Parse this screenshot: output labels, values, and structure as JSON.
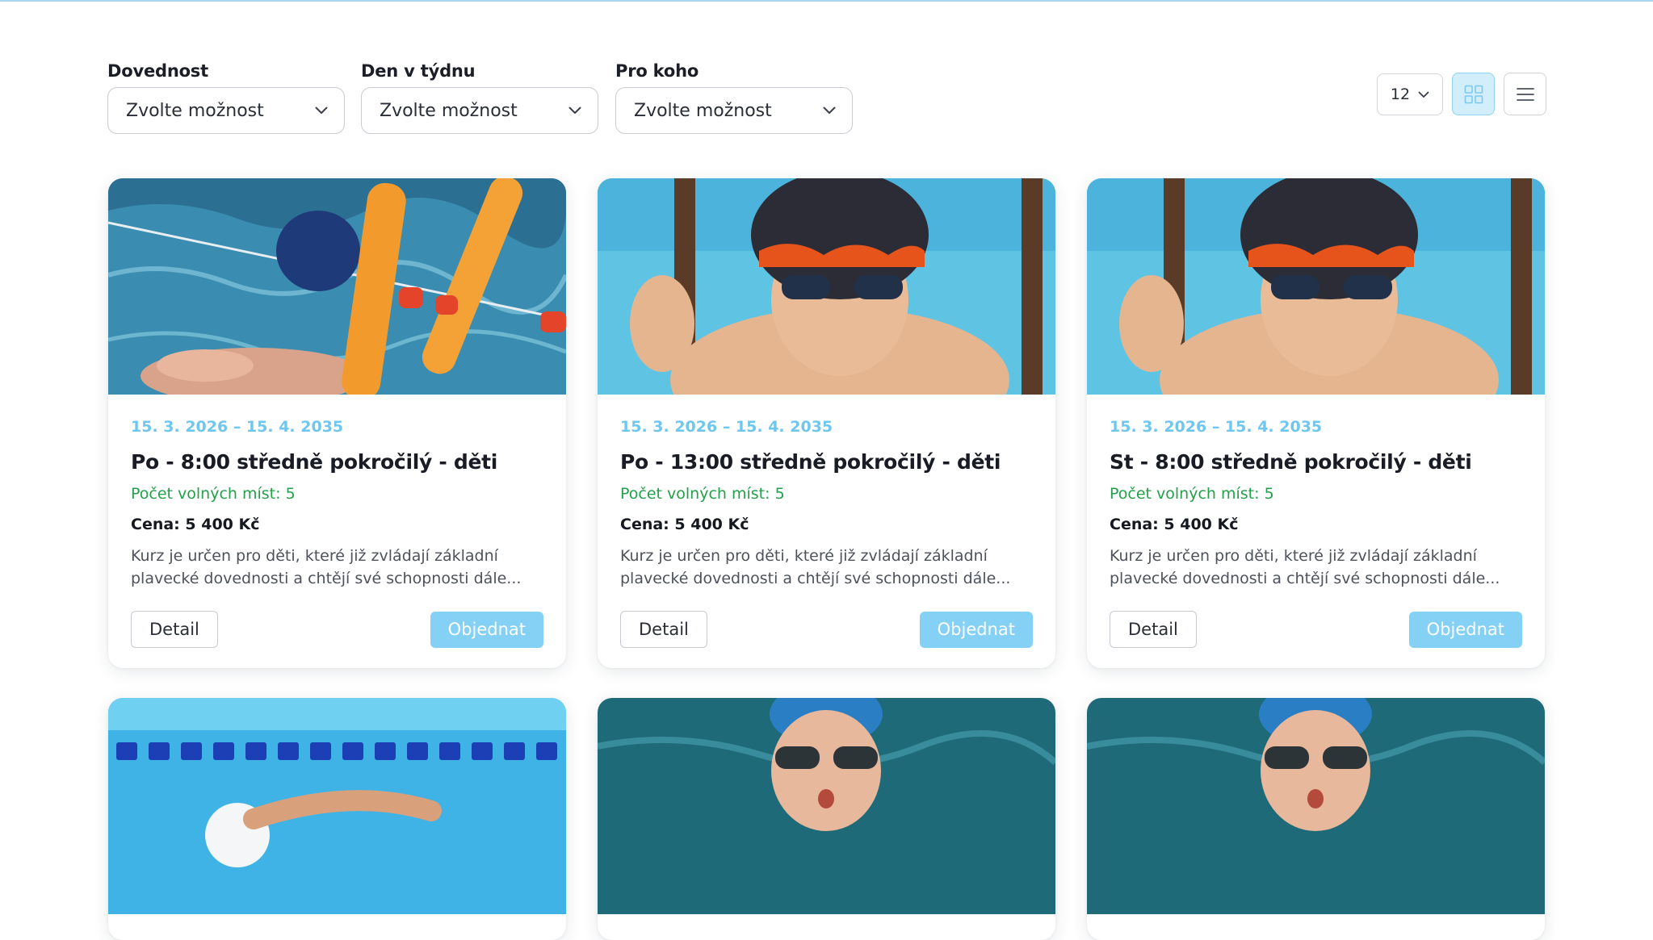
{
  "filters": [
    {
      "label": "Dovednost",
      "value": "Zvolte možnost"
    },
    {
      "label": "Den v týdnu",
      "value": "Zvolte možnost"
    },
    {
      "label": "Pro koho",
      "value": "Zvolte možnost"
    }
  ],
  "toolbar": {
    "per_page": "12",
    "grid_view_icon": "grid-icon",
    "list_view_icon": "list-icon",
    "active_view": "grid",
    "accent_color": "#85d1f5"
  },
  "cards": [
    {
      "image": "child-swimmer-with-pool-noodles",
      "dates": "15. 3. 2026 – 15. 4. 2035",
      "title": "Po - 8:00 středně pokročilý - děti",
      "spots": "Počet volných míst: 5",
      "price": "Cena: 5 400 Kč",
      "description": "Kurz je určen pro děti, které již zvládají základní plavecké dovednosti a chtějí své schopnosti dále...",
      "detail_label": "Detail",
      "order_label": "Objednat"
    },
    {
      "image": "boy-with-goggles-at-pool-ladder",
      "dates": "15. 3. 2026 – 15. 4. 2035",
      "title": "Po - 13:00 středně pokročilý - děti",
      "spots": "Počet volných míst: 5",
      "price": "Cena: 5 400 Kč",
      "description": "Kurz je určen pro děti, které již zvládají základní plavecké dovednosti a chtějí své schopnosti dále...",
      "detail_label": "Detail",
      "order_label": "Objednat"
    },
    {
      "image": "boy-with-goggles-at-pool-ladder",
      "dates": "15. 3. 2026 – 15. 4. 2035",
      "title": "St - 8:00 středně pokročilý - děti",
      "spots": "Počet volných míst: 5",
      "price": "Cena: 5 400 Kč",
      "description": "Kurz je určen pro děti, které již zvládají základní plavecké dovednosti a chtějí své schopnosti dále...",
      "detail_label": "Detail",
      "order_label": "Objednat"
    },
    {
      "image": "swimmer-freestyle-lane-rope"
    },
    {
      "image": "butterfly-swimmer-with-goggles"
    },
    {
      "image": "butterfly-swimmer-with-goggles"
    }
  ]
}
